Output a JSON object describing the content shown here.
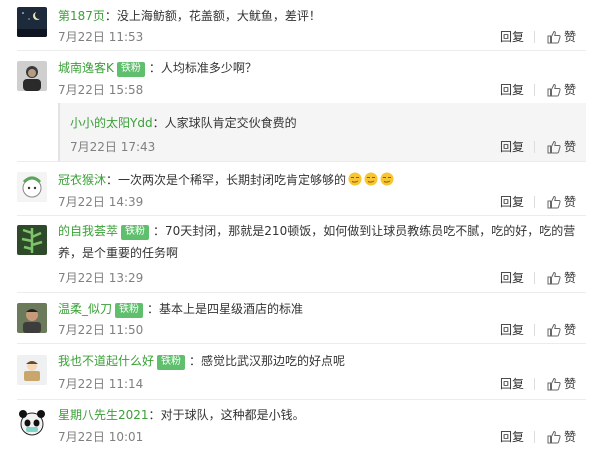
{
  "action_labels": {
    "reply": "回复",
    "like": "赞"
  },
  "comments": [
    {
      "user": "第187页",
      "badge": "",
      "text": "没上海鲂额，花盖额，大鱿鱼，差评！",
      "time": "7月22日 11:53"
    },
    {
      "user": "城南逸客K",
      "badge": "铁粉",
      "text": "人均标准多少啊？",
      "time": "7月22日 15:58",
      "sub_reply": {
        "user": "小小的太阳Ydd",
        "text": "人家球队肯定交伙食费的",
        "time": "7月22日 17:43"
      }
    },
    {
      "user": "冠衣猴沐",
      "badge": "",
      "text": "一次两次是个稀罕，长期封闭吃肯定够够的",
      "time": "7月22日 14:39"
    },
    {
      "user": "的自我荟萃",
      "badge": "铁粉",
      "text": "70天封闭，那就是210顿饭，如何做到让球员教练员吃不腻，吃的好，吃的营养，是个重要的任务啊",
      "time": "7月22日 13:29"
    },
    {
      "user": "温柔_似刀",
      "badge": "铁粉",
      "text": "基本上是四星级酒店的标准",
      "time": "7月22日 11:50"
    },
    {
      "user": "我也不道起什么好",
      "badge": "铁粉",
      "text": "感觉比武汉那边吃的好点呢",
      "time": "7月22日 11:14"
    },
    {
      "user": "星期八先生2021",
      "badge": "",
      "text": "对于球队，这种都是小钱。",
      "time": "7月22日 10:01"
    }
  ]
}
